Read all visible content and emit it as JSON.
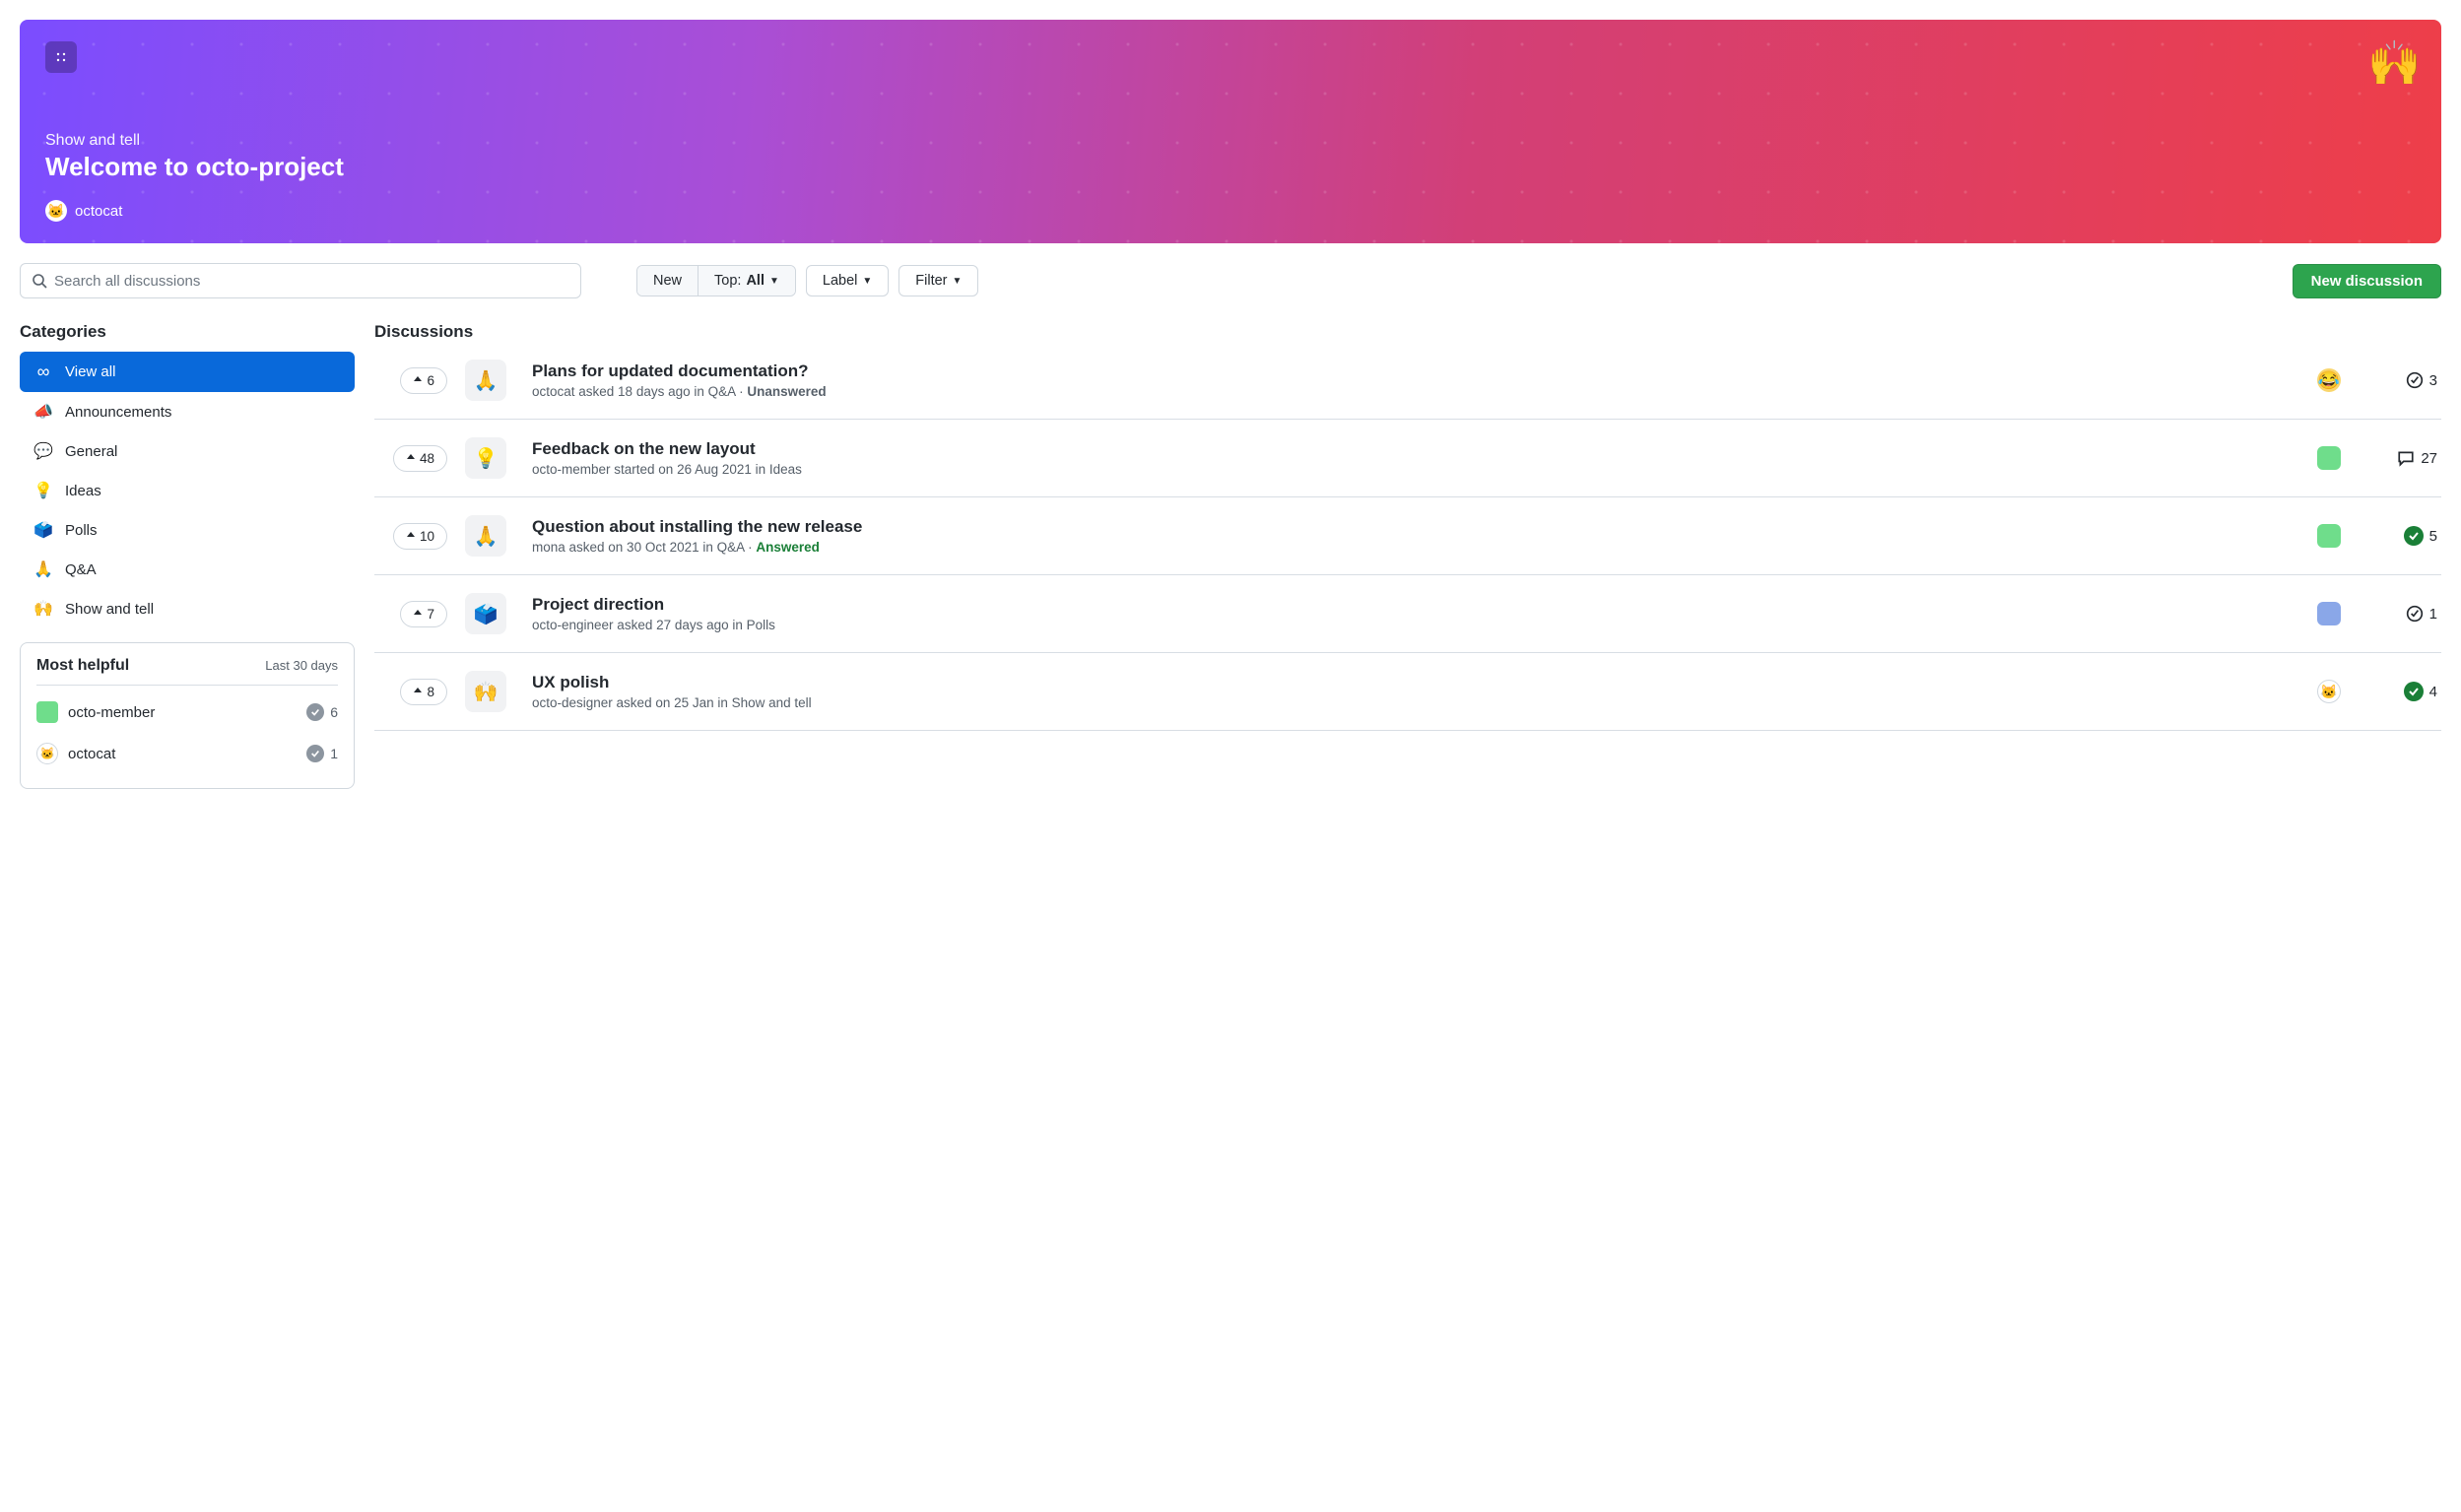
{
  "hero": {
    "category": "Show and tell",
    "title": "Welcome to octo-project",
    "author": "octocat",
    "emoji": "🙌"
  },
  "toolbar": {
    "search_placeholder": "Search all discussions",
    "new_label": "New",
    "top_label_prefix": "Top: ",
    "top_value": "All",
    "label_label": "Label",
    "filter_label": "Filter",
    "new_discussion_label": "New discussion"
  },
  "sidebar": {
    "categories_heading": "Categories",
    "categories": [
      {
        "icon": "∞",
        "label": "View all",
        "active": true
      },
      {
        "icon": "📣",
        "label": "Announcements",
        "active": false
      },
      {
        "icon": "💬",
        "label": "General",
        "active": false
      },
      {
        "icon": "💡",
        "label": "Ideas",
        "active": false
      },
      {
        "icon": "🗳️",
        "label": "Polls",
        "active": false
      },
      {
        "icon": "🙏",
        "label": "Q&A",
        "active": false
      },
      {
        "icon": "🙌",
        "label": "Show and tell",
        "active": false
      }
    ],
    "most_helpful_heading": "Most helpful",
    "most_helpful_period": "Last 30 days",
    "most_helpful": [
      {
        "name": "octo-member",
        "count": 6
      },
      {
        "name": "octocat",
        "count": 1
      }
    ]
  },
  "discussions_heading": "Discussions",
  "discussions": [
    {
      "votes": 6,
      "icon": "🙏",
      "title": "Plans for updated documentation?",
      "meta": "octocat asked 18 days ago in Q&A",
      "status": "Unanswered",
      "status_class": "unanswered",
      "count": 3,
      "count_type": "check",
      "pclass": "p0",
      "pglyph": "😂"
    },
    {
      "votes": 48,
      "icon": "💡",
      "title": "Feedback on the new layout",
      "meta": "octo-member started on 26 Aug 2021 in Ideas",
      "status": "",
      "status_class": "",
      "count": 27,
      "count_type": "comment",
      "pclass": "p1",
      "pglyph": ""
    },
    {
      "votes": 10,
      "icon": "🙏",
      "title": "Question about installing the new release",
      "meta": "mona asked on 30 Oct 2021 in Q&A",
      "status": "Answered",
      "status_class": "answered",
      "count": 5,
      "count_type": "solved",
      "pclass": "p2",
      "pglyph": ""
    },
    {
      "votes": 7,
      "icon": "🗳️",
      "title": "Project direction",
      "meta": "octo-engineer asked 27 days ago in Polls",
      "status": "",
      "status_class": "",
      "count": 1,
      "count_type": "check",
      "pclass": "p3",
      "pglyph": ""
    },
    {
      "votes": 8,
      "icon": "🙌",
      "title": "UX polish",
      "meta": "octo-designer asked on 25 Jan in Show and tell",
      "status": "",
      "status_class": "",
      "count": 4,
      "count_type": "solved",
      "pclass": "p4",
      "pglyph": "🐱"
    }
  ]
}
